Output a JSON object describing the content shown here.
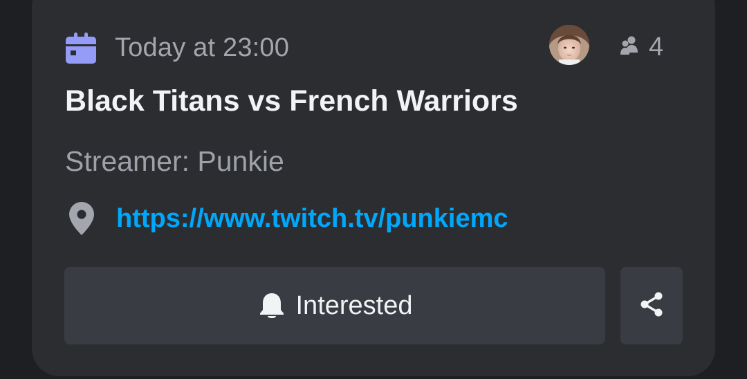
{
  "event": {
    "date_text": "Today at 23:00",
    "title": "Black Titans vs French Warriors",
    "description": "Streamer: Punkie",
    "location_link": "https://www.twitch.tv/punkiemc",
    "attendee_count": "4",
    "calendar_icon": "calendar-icon",
    "attendees_icon": "people-icon",
    "location_icon": "location-pin-icon"
  },
  "actions": {
    "interested_label": "Interested",
    "interested_icon": "bell-icon",
    "share_icon": "share-icon"
  },
  "colors": {
    "background": "#1e1f22",
    "card": "#2b2d31",
    "button": "#393c43",
    "accent_calendar": "#949cf7",
    "link": "#00a8fc",
    "muted_text": "#a4a6ad",
    "title_text": "#f2f3f5"
  }
}
